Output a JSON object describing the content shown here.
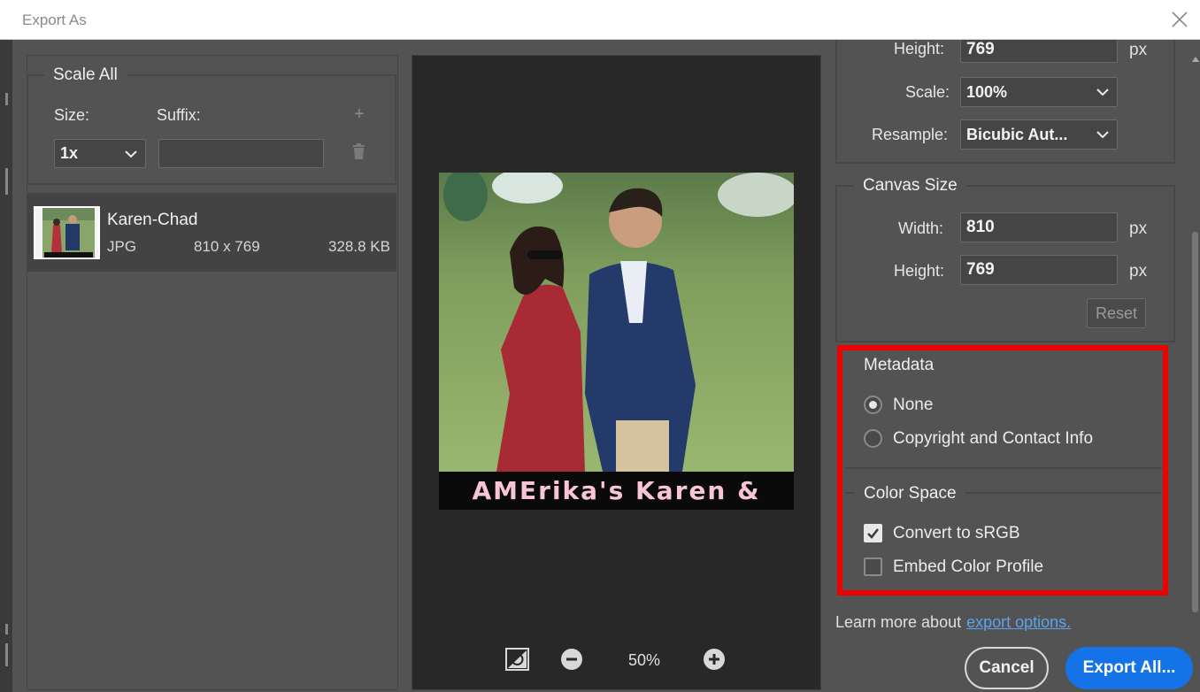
{
  "window": {
    "title": "Export As"
  },
  "scale_all": {
    "legend": "Scale All",
    "size_label": "Size:",
    "suffix_label": "Suffix:",
    "size_value": "1x",
    "suffix_value": ""
  },
  "asset": {
    "name": "Karen-Chad",
    "format": "JPG",
    "dimensions": "810 x 769",
    "filesize": "328.8 KB"
  },
  "preview": {
    "caption": "AMErika's Karen & CHad",
    "zoom": "50%"
  },
  "image_size": {
    "height_label": "Height:",
    "height_value": "769",
    "unit": "px",
    "scale_label": "Scale:",
    "scale_value": "100%",
    "resample_label": "Resample:",
    "resample_value": "Bicubic Aut..."
  },
  "canvas_size": {
    "legend": "Canvas Size",
    "width_label": "Width:",
    "width_value": "810",
    "height_label": "Height:",
    "height_value": "769",
    "unit": "px",
    "reset_label": "Reset"
  },
  "metadata": {
    "legend": "Metadata",
    "options": [
      "None",
      "Copyright and Contact Info"
    ],
    "selected": "None"
  },
  "color_space": {
    "legend": "Color Space",
    "convert_label": "Convert to sRGB",
    "convert_checked": true,
    "embed_label": "Embed Color Profile",
    "embed_checked": false
  },
  "footer": {
    "learn_text": "Learn more about",
    "learn_link": "export options.",
    "cancel_label": "Cancel",
    "export_label": "Export All..."
  },
  "colors": {
    "accent": "#1473e6",
    "highlight": "#ee0000",
    "panel": "#535353"
  }
}
